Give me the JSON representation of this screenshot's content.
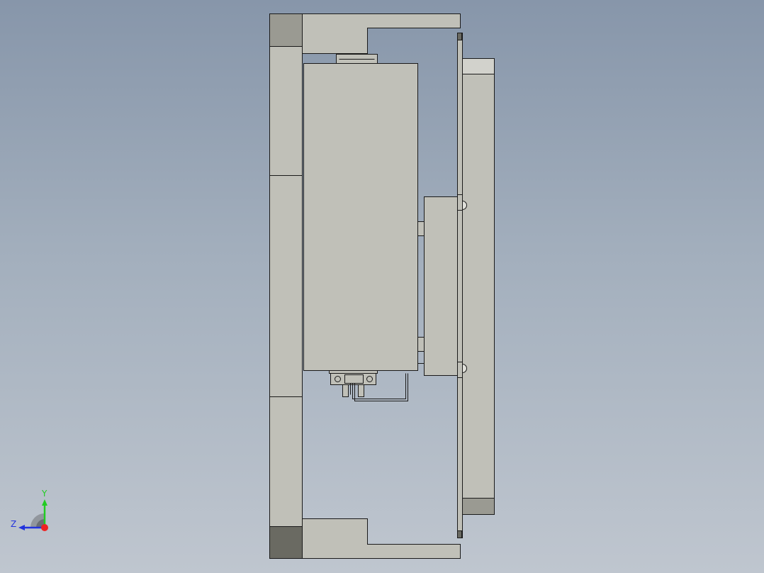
{
  "viewport": {
    "background_top": "#8796aa",
    "background_bottom": "#bfc6cf"
  },
  "model": {
    "part_fill": "#c0c0b8",
    "part_stroke": "#1a1a1a",
    "dark_face": "#6a6a62",
    "shade_face": "#9a9a92"
  },
  "triad": {
    "y_label": "Y",
    "z_label": "Z",
    "y_color": "#22cc22",
    "z_color": "#2233dd",
    "origin_color": "#ee2222"
  }
}
